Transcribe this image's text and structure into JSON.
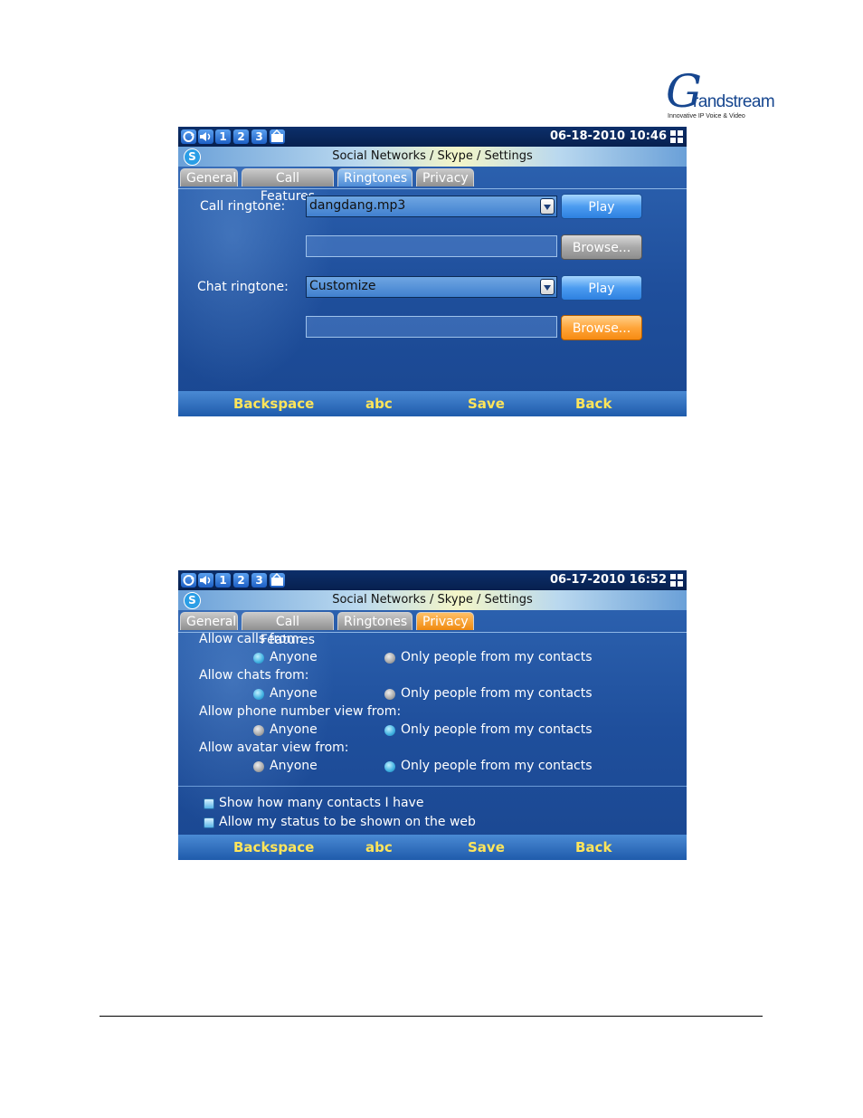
{
  "logo": {
    "letter": "G",
    "word": "randstream",
    "tagline": "Innovative IP Voice & Video"
  },
  "screen1": {
    "status": {
      "icons": [
        "sync-icon",
        "speaker-icon"
      ],
      "lines": [
        "1",
        "2",
        "3"
      ],
      "datetime": "06-18-2010 10:46"
    },
    "title": "Social Networks / Skype / Settings",
    "tabs": [
      "General",
      "Call Features",
      "Ringtones",
      "Privacy"
    ],
    "active_tab": "Ringtones",
    "call_ringtone_label": "Call ringtone:",
    "call_ringtone_value": "dangdang.mp3",
    "chat_ringtone_label": "Chat ringtone:",
    "chat_ringtone_value": "Customize",
    "play_label": "Play",
    "browse_label": "Browse...",
    "softkeys": [
      "Backspace",
      "abc",
      "Save",
      "Back"
    ]
  },
  "screen2": {
    "status": {
      "datetime": "06-17-2010 16:52"
    },
    "title": "Social Networks / Skype / Settings",
    "tabs": [
      "General",
      "Call Features",
      "Ringtones",
      "Privacy"
    ],
    "active_tab": "Privacy",
    "groups": [
      {
        "label": "Allow calls from:",
        "options": [
          "Anyone",
          "Only people from my contacts"
        ],
        "selected": "Anyone"
      },
      {
        "label": "Allow chats from:",
        "options": [
          "Anyone",
          "Only people from my contacts"
        ],
        "selected": "Anyone"
      },
      {
        "label": "Allow phone number view from:",
        "options": [
          "Anyone",
          "Only people from my contacts"
        ],
        "selected": "Only people from my contacts"
      },
      {
        "label": "Allow avatar view from:",
        "options": [
          "Anyone",
          "Only people from my contacts"
        ],
        "selected": "Only people from my contacts"
      }
    ],
    "checkboxes": [
      "Show how many contacts I have",
      "Allow my status to be shown on the web"
    ],
    "softkeys": [
      "Backspace",
      "abc",
      "Save",
      "Back"
    ]
  },
  "colors": {
    "screen_blue": "#2f66b4",
    "softkey_text": "#ffe55a",
    "active_orange": "#f08a10",
    "logo_blue": "#16468f"
  }
}
